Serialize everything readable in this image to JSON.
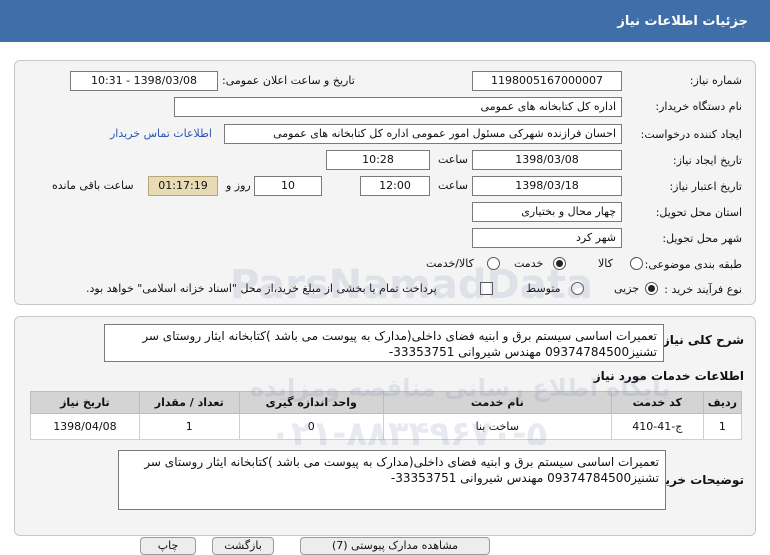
{
  "header": {
    "title": "جزئیات اطلاعات نیاز"
  },
  "form": {
    "need_number": {
      "label": "شماره نیاز:",
      "value": "1198005167000007"
    },
    "announce": {
      "label": "تاریخ و ساعت اعلان عمومی:",
      "value": "1398/03/08 - 10:31"
    },
    "buyer": {
      "label": "نام دستگاه خریدار:",
      "value": "اداره کل کتابخانه های عمومی"
    },
    "requester": {
      "label": "ایجاد کننده درخواست:",
      "value": "احسان فرازنده شهرکی مسئول امور عمومی اداره کل کتابخانه های عمومی",
      "contact_link": "اطلاعات تماس خریدار"
    },
    "created": {
      "label": "تاریخ ایجاد نیاز:",
      "date": "1398/03/08",
      "time_label": "ساعت",
      "time": "10:28"
    },
    "validity": {
      "label": "تاریخ اعتبار نیاز:",
      "date": "1398/03/18",
      "time_label": "ساعت",
      "time": "12:00",
      "days": "10",
      "days_label": "روز و",
      "remaining": "01:17:19",
      "remaining_label": "ساعت باقی مانده"
    },
    "province": {
      "label": "استان محل تحویل:",
      "value": "چهار محال و بختیاری"
    },
    "city": {
      "label": "شهر محل تحویل:",
      "value": "شهر کرد"
    },
    "category": {
      "label": "طبقه بندی موضوعی:",
      "options": [
        "کالا",
        "خدمت",
        "کالا/خدمت"
      ],
      "selected": "خدمت"
    },
    "process": {
      "label": "نوع فرآیند خرید :",
      "options": [
        "جزیی",
        "متوسط"
      ],
      "selected": "جزیی",
      "note": "پرداخت تمام یا بخشی از مبلغ خرید،از محل \"اسناد خزانه اسلامی\" خواهد بود."
    }
  },
  "summary": {
    "label": "شرح کلی نیاز:",
    "text": "تعمیرات اساسی سیستم برق و ابنیه فضای داخلی(مدارک به پیوست می باشد )کتابخانه ایثار روستای سر تشنیز09374784500 مهندس شیروانی 33353751-"
  },
  "services": {
    "title": "اطلاعات خدمات مورد نیاز",
    "columns": [
      "ردیف",
      "کد خدمت",
      "نام خدمت",
      "واحد اندازه گیری",
      "تعداد / مقدار",
      "تاریخ نیاز"
    ],
    "rows": [
      [
        "1",
        "ج-41-410",
        "ساخت بنا",
        "0",
        "1",
        "1398/04/08"
      ]
    ]
  },
  "description": {
    "label": "توضیحات خریدار:",
    "text": "تعمیرات اساسی سیستم برق و ابنیه فضای داخلی(مدارک به پیوست می باشد )کتابخانه ایثار روستای سر تشنیز09374784500 مهندس شیروانی 33353751-"
  },
  "watermark": {
    "line1": "ParsNamadData",
    "line2": "پایگاه اطلاع رسانی مناقصه ومزایده",
    "line3": "۰۲۱-۸۸۳۴۹۶۷۰-۵"
  },
  "footer": {
    "buttons": [
      "بازگشت",
      "چاپ",
      "مشاهده مدارک پیوستی (7)"
    ]
  },
  "colors": {
    "header": "#3f6ea8",
    "link": "#2a56b8",
    "remaining_bg": "#e6dbb4"
  }
}
